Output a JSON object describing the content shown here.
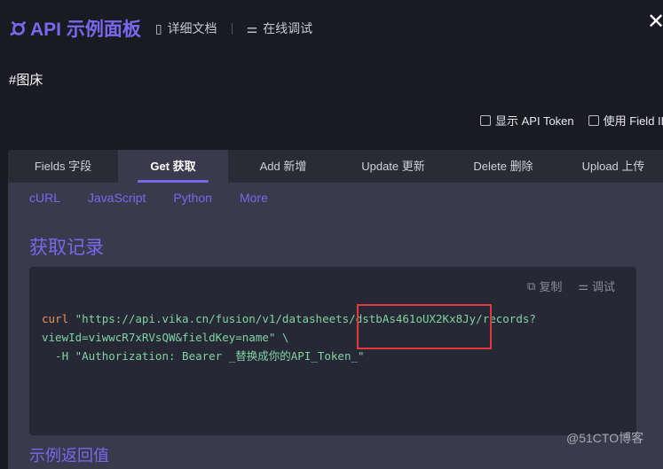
{
  "header": {
    "logo": "API 示例面板",
    "docs": "详细文档",
    "debug": "在线调试",
    "close": "✕"
  },
  "page_title": "#图床",
  "options": [
    "显示 API Token",
    "使用 Field ID"
  ],
  "tabs": [
    "Fields 字段",
    "Get 获取",
    "Add 新增",
    "Update 更新",
    "Delete 删除",
    "Upload 上传"
  ],
  "active_tab": "Get 获取",
  "langs": [
    "cURL",
    "JavaScript",
    "Python",
    "More"
  ],
  "section_title": "获取记录",
  "code_actions": {
    "copy": "复制",
    "debug": "调试"
  },
  "code": {
    "kw": "curl",
    "line1": " \"https://api.vika.cn/fusion/v1/datasheets/dstbAs461oUX2Kx8Jy/records?",
    "line2": "viewId=viwwcR7xRVsQW&fieldKey=name\" \\",
    "line3": "  -H \"Authorization: Bearer _替换成你的API_Token_\""
  },
  "example_title": "示例返回值",
  "watermark": "@51CTO博客",
  "colors": {
    "accent": "#7b67ee",
    "highlight": "#e03a3a"
  }
}
